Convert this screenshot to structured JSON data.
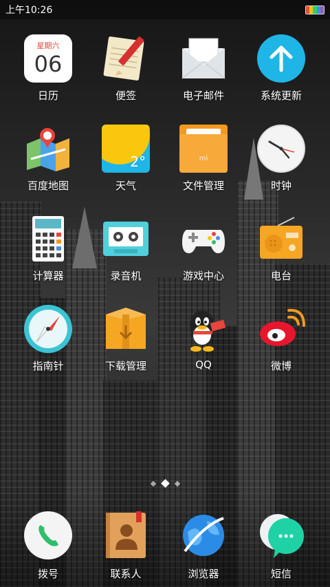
{
  "status_bar": {
    "time": "上午10:26"
  },
  "apps": {
    "calendar": {
      "label": "日历",
      "weekday": "星期六",
      "day": "06"
    },
    "notes": {
      "label": "便签"
    },
    "email": {
      "label": "电子邮件"
    },
    "system_update": {
      "label": "系统更新"
    },
    "baidu_maps": {
      "label": "百度地图",
      "badge": "du"
    },
    "weather": {
      "label": "天气",
      "temp": "2°"
    },
    "file_manager": {
      "label": "文件管理",
      "brand": "mi"
    },
    "clock": {
      "label": "时钟"
    },
    "calculator": {
      "label": "计算器"
    },
    "recorder": {
      "label": "录音机"
    },
    "game_center": {
      "label": "游戏中心"
    },
    "radio": {
      "label": "电台"
    },
    "compass": {
      "label": "指南针"
    },
    "downloads": {
      "label": "下载管理"
    },
    "qq": {
      "label": "QQ"
    },
    "weibo": {
      "label": "微博"
    }
  },
  "dock": {
    "dialer": {
      "label": "拨号"
    },
    "contacts": {
      "label": "联系人"
    },
    "browser": {
      "label": "浏览器"
    },
    "messages": {
      "label": "短信"
    }
  },
  "page_indicator": {
    "pages": 3,
    "active": 2
  },
  "colors": {
    "update_blue": "#1fb5e6",
    "weather_yellow": "#f9c80e",
    "file_orange": "#f39a1f",
    "dialer_green": "#2fbf6a",
    "messages_teal": "#1fd2a5"
  }
}
